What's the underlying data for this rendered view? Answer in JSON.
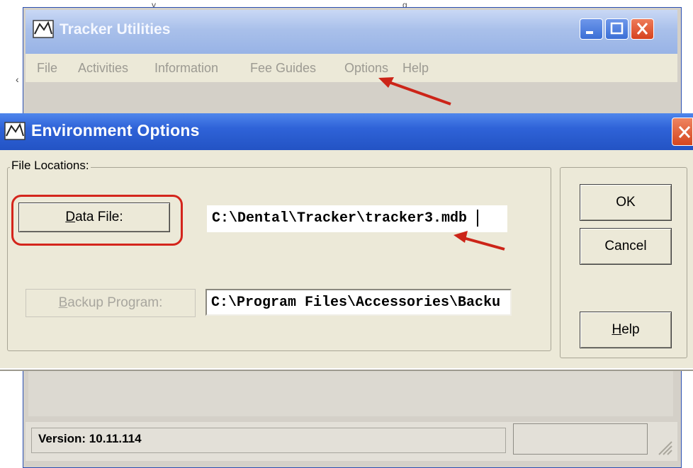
{
  "background_window": {
    "title": "Tracker Utilities",
    "menu": [
      "File",
      "Activities",
      "Information",
      "Fee Guides",
      "Options",
      "Help"
    ],
    "status_version": "Version: 10.11.114",
    "left_edge_glyph": "‹",
    "top_cropped_glyphs": [
      "y",
      "g"
    ]
  },
  "dialog": {
    "title": "Environment Options",
    "group_label": "File Locations:",
    "data_file": {
      "button_label_mnemonic": "D",
      "button_label_rest": "ata File:",
      "value": "C:\\Dental\\Tracker\\tracker3.mdb"
    },
    "backup": {
      "button_label_mnemonic": "B",
      "button_label_rest": "ackup Program:",
      "value": "C:\\Program Files\\Accessories\\Backu"
    },
    "ok_label": "OK",
    "cancel_label": "Cancel",
    "help_label_mnemonic": "H",
    "help_label_rest": "elp"
  },
  "colors": {
    "dialog_titlebar": "#2f63d8",
    "annotation_red": "#d4251c",
    "dialog_face": "#ece9d8"
  }
}
